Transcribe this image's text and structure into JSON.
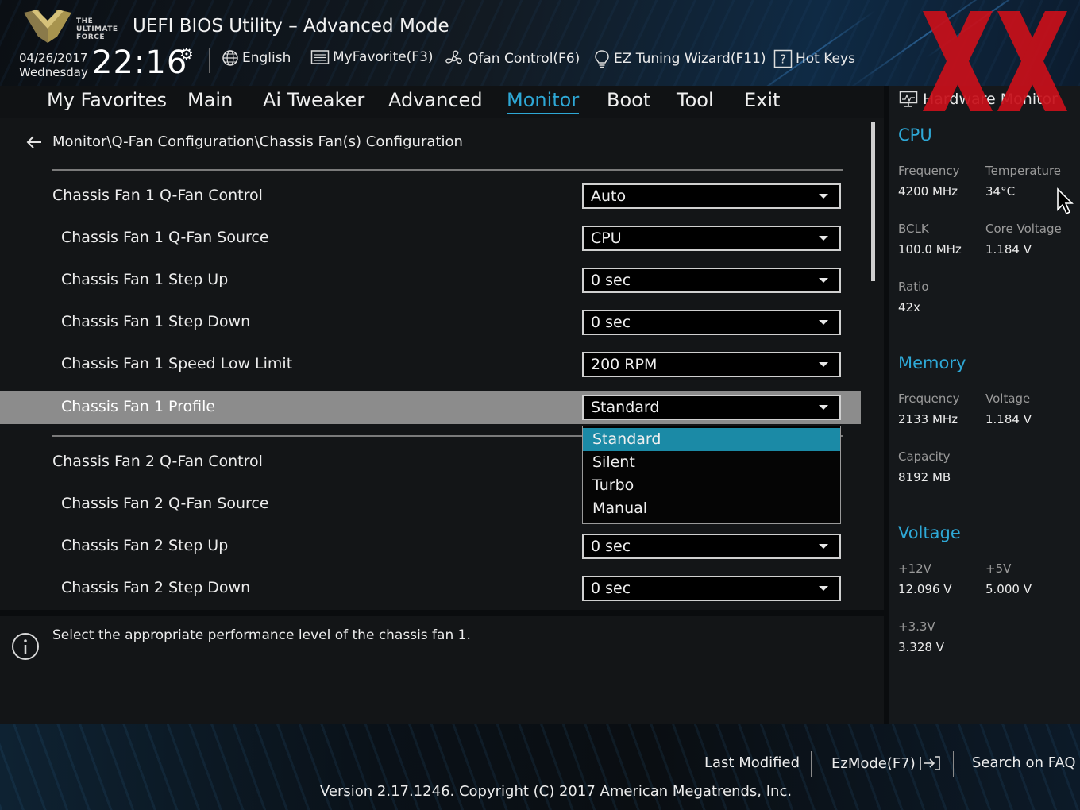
{
  "header": {
    "logo_text": "THE ULTIMATE FORCE",
    "title": "UEFI BIOS Utility – Advanced Mode",
    "date": "04/26/2017",
    "weekday": "Wednesday",
    "time": "22:16",
    "tools": {
      "language": "English",
      "my_favorite": "MyFavorite(F3)",
      "qfan": "Qfan Control(F6)",
      "ez_tuning": "EZ Tuning Wizard(F11)",
      "hot_keys": "Hot Keys"
    }
  },
  "nav": {
    "tabs": [
      "My Favorites",
      "Main",
      "Ai Tweaker",
      "Advanced",
      "Monitor",
      "Boot",
      "Tool",
      "Exit"
    ],
    "active": "Monitor"
  },
  "main": {
    "breadcrumb": "Monitor\\Q-Fan Configuration\\Chassis Fan(s) Configuration",
    "rows": [
      {
        "label": "Chassis Fan 1 Q-Fan Control",
        "value": "Auto"
      },
      {
        "label": "Chassis Fan 1 Q-Fan Source",
        "value": "CPU"
      },
      {
        "label": "Chassis Fan 1 Step Up",
        "value": "0 sec"
      },
      {
        "label": "Chassis Fan 1 Step Down",
        "value": "0 sec"
      },
      {
        "label": "Chassis Fan 1 Speed Low Limit",
        "value": "200 RPM"
      },
      {
        "label": "Chassis Fan 1 Profile",
        "value": "Standard"
      },
      {
        "label": "Chassis Fan 2 Q-Fan Control",
        "value": ""
      },
      {
        "label": "Chassis Fan 2 Q-Fan Source",
        "value": ""
      },
      {
        "label": "Chassis Fan 2 Step Up",
        "value": "0 sec"
      },
      {
        "label": "Chassis Fan 2 Step Down",
        "value": "0 sec"
      }
    ],
    "dropdown": {
      "options": [
        "Standard",
        "Silent",
        "Turbo",
        "Manual"
      ],
      "selected": "Standard"
    }
  },
  "help": {
    "text": "Select the appropriate performance level of the chassis fan 1."
  },
  "hardware_monitor": {
    "title": "Hardware Monitor",
    "cpu": {
      "heading": "CPU",
      "frequency_label": "Frequency",
      "frequency": "4200 MHz",
      "temperature_label": "Temperature",
      "temperature": "34°C",
      "bclk_label": "BCLK",
      "bclk": "100.0 MHz",
      "core_voltage_label": "Core Voltage",
      "core_voltage": "1.184 V",
      "ratio_label": "Ratio",
      "ratio": "42x"
    },
    "memory": {
      "heading": "Memory",
      "frequency_label": "Frequency",
      "frequency": "2133 MHz",
      "voltage_label": "Voltage",
      "voltage": "1.184 V",
      "capacity_label": "Capacity",
      "capacity": "8192 MB"
    },
    "voltage": {
      "heading": "Voltage",
      "v12_label": "+12V",
      "v12": "12.096 V",
      "v5_label": "+5V",
      "v5": "5.000 V",
      "v33_label": "+3.3V",
      "v33": "3.328 V"
    }
  },
  "footer": {
    "last_modified": "Last Modified",
    "ezmode": "EzMode(F7)",
    "search_faq": "Search on FAQ",
    "version": "Version 2.17.1246. Copyright (C) 2017 American Megatrends, Inc."
  },
  "colors": {
    "accent": "#2ea8d6",
    "dropdown_selected": "#1b8aa6",
    "highlight_row": "#8c8c8c",
    "watermark": "#c8101a"
  }
}
